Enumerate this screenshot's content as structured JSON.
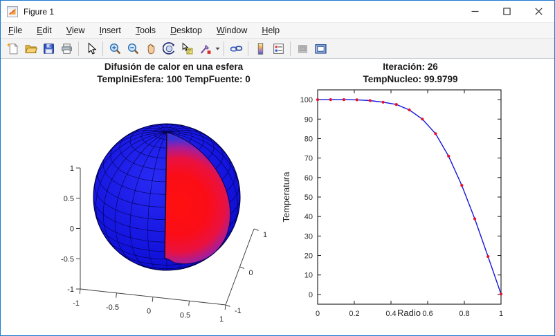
{
  "window": {
    "title": "Figure 1"
  },
  "menu": {
    "items": [
      "File",
      "Edit",
      "View",
      "Insert",
      "Tools",
      "Desktop",
      "Window",
      "Help"
    ]
  },
  "toolbar": {
    "buttons": [
      "new-figure",
      "open-file",
      "save-figure",
      "print-figure",
      "edit-plot-pointer",
      "zoom-in",
      "zoom-out",
      "pan-hand",
      "rotate-3d",
      "data-cursor",
      "brush-data",
      "link-plot",
      "insert-colorbar",
      "insert-legend",
      "hide-plot-tools",
      "show-plot-tools-dock"
    ]
  },
  "chart_data": [
    {
      "type": "surface",
      "title": "Difusión de calor en una esfera",
      "subtitle": "TempIniEsfera: 100 TempFuente: 0",
      "description": "Cutaway sphere (quarter wedge removed) showing radial heat diffusion: hot red core (~100) fading to cold blue surface (~0), blue wireframe mesh on outer surface",
      "xlim": [
        -1,
        1
      ],
      "ylim": [
        -1,
        1
      ],
      "zlim": [
        -1,
        1
      ],
      "xticks": [
        -1,
        -0.5,
        0,
        0.5,
        1
      ],
      "yticks": [
        -1,
        0,
        1
      ],
      "zticks": [
        1,
        0.5,
        0,
        -0.5,
        -1
      ],
      "surface_color": "#1414e8",
      "wire_color": "#00004d",
      "core_color": "#ff1010",
      "rim_color": "#3a34d8"
    },
    {
      "type": "line",
      "title": "Iteración: 26",
      "subtitle": "TempNucleo: 99.9799",
      "xlabel": "Radio",
      "ylabel": "Temperatura",
      "x": [
        0,
        0.071,
        0.143,
        0.214,
        0.286,
        0.357,
        0.429,
        0.5,
        0.571,
        0.643,
        0.714,
        0.786,
        0.857,
        0.929,
        1
      ],
      "y": [
        99.98,
        100,
        100,
        99.9,
        99.5,
        98.7,
        97.5,
        94.7,
        90,
        82.5,
        71,
        56,
        38.8,
        19.5,
        0.2
      ],
      "xlim": [
        0,
        1
      ],
      "ylim": [
        -5,
        105
      ],
      "xticks": [
        0,
        0.2,
        0.4,
        0.6,
        0.8,
        1
      ],
      "yticks": [
        0,
        10,
        20,
        30,
        40,
        50,
        60,
        70,
        80,
        90,
        100
      ],
      "line_color": "#1414dc",
      "marker_color": "#e8112d",
      "marker": "dot",
      "grid": false
    }
  ]
}
